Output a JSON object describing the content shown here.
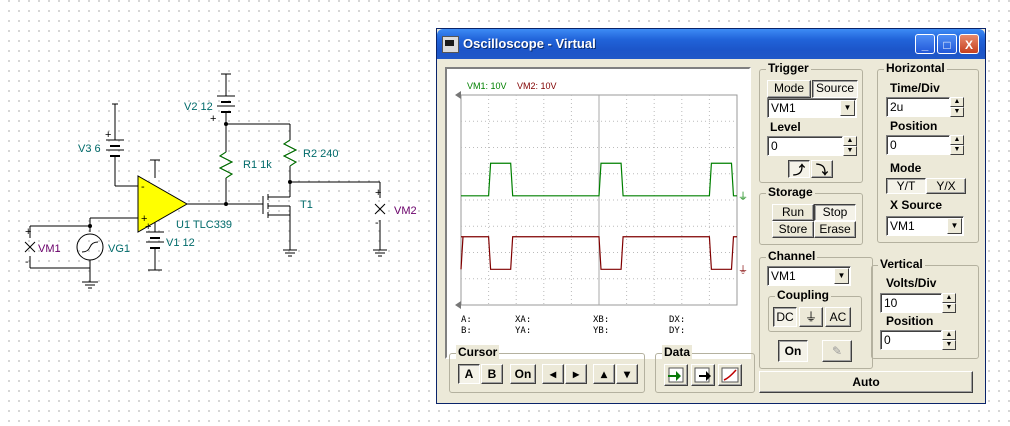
{
  "schematic": {
    "v3_label": "V3 6",
    "v2_label": "V2 12",
    "v1_label": "V1 12",
    "r1_label": "R1 1k",
    "r2_label": "R2 240",
    "u1_label": "U1 TLC339",
    "t1_label": "T1",
    "vg1_label": "VG1",
    "vm1_label": "VM1",
    "vm2_label": "VM2",
    "plus": "+",
    "minus": "-"
  },
  "window": {
    "title": "Oscilloscope - Virtual",
    "minimize": "_",
    "maximize": "□",
    "close": "X"
  },
  "screen": {
    "legend_vm1": "VM1: 10V",
    "legend_vm2": "VM2: 10V",
    "readouts": {
      "a": "A:",
      "b": "B:",
      "xa": "XA:",
      "ya": "YA:",
      "xb": "XB:",
      "yb": "YB:",
      "dx": "DX:",
      "dy": "DY:"
    }
  },
  "trigger": {
    "title": "Trigger",
    "mode": "Mode",
    "source": "Source",
    "source_value": "VM1",
    "level_label": "Level",
    "level_value": "0",
    "rising_edge": "⨍",
    "falling_edge": "⨍"
  },
  "horizontal": {
    "title": "Horizontal",
    "timediv_label": "Time/Div",
    "timediv_value": "2u",
    "position_label": "Position",
    "position_value": "0",
    "mode_label": "Mode",
    "yt": "Y/T",
    "yx": "Y/X",
    "xsource_label": "X Source",
    "xsource_value": "VM1"
  },
  "storage": {
    "title": "Storage",
    "run": "Run",
    "stop": "Stop",
    "store": "Store",
    "erase": "Erase"
  },
  "channel": {
    "title": "Channel",
    "value": "VM1",
    "coupling_title": "Coupling",
    "dc": "DC",
    "gnd": "⏚",
    "ac": "AC",
    "on": "On"
  },
  "vertical": {
    "title": "Vertical",
    "voltsdiv_label": "Volts/Div",
    "voltsdiv_value": "10",
    "position_label": "Position",
    "position_value": "0"
  },
  "cursor": {
    "title": "Cursor",
    "a": "A",
    "b": "B",
    "on": "On",
    "left": "◂",
    "right": "▸",
    "up": "▴",
    "down": "▾"
  },
  "data_group": {
    "title": "Data"
  },
  "auto": "Auto",
  "colors": {
    "vm1": "#008000",
    "vm2": "#800000",
    "opamp": "#ffff00",
    "wire": "#000000",
    "comp_label": "#006a6a"
  },
  "traces": {
    "vm1_pulses_div": [
      [
        1.0,
        1.8
      ],
      [
        5.0,
        5.8
      ],
      [
        9.0,
        9.8
      ]
    ],
    "vm2_low_div": [
      [
        1.0,
        1.8
      ],
      [
        5.0,
        5.8
      ],
      [
        9.0,
        9.8
      ]
    ]
  }
}
